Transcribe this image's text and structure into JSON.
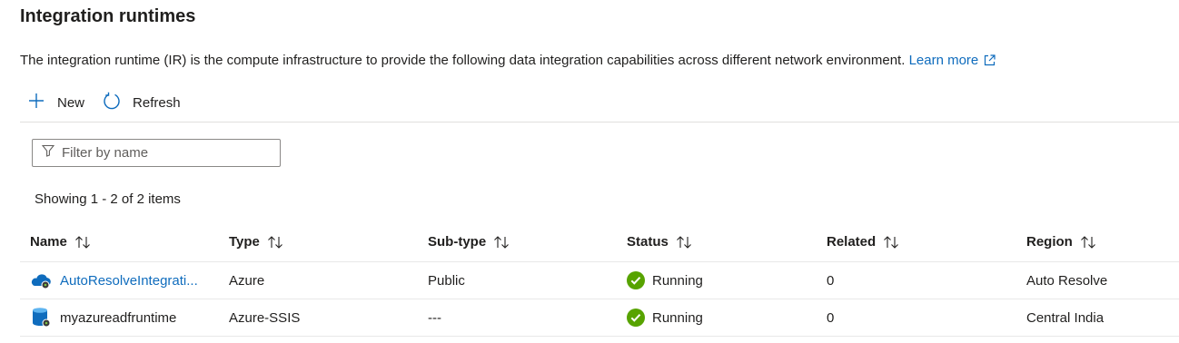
{
  "page": {
    "title": "Integration runtimes",
    "description": "The integration runtime (IR) is the compute infrastructure to provide the following data integration capabilities across different network environment.",
    "learn_more": "Learn more"
  },
  "toolbar": {
    "new_label": "New",
    "refresh_label": "Refresh"
  },
  "filter": {
    "placeholder": "Filter by name",
    "value": ""
  },
  "summary": "Showing 1 - 2 of 2 items",
  "table": {
    "headers": [
      "Name",
      "Type",
      "Sub-type",
      "Status",
      "Related",
      "Region"
    ],
    "rows": [
      {
        "name": "AutoResolveIntegrati...",
        "type": "Azure",
        "subtype": "Public",
        "status": "Running",
        "related": "0",
        "region": "Auto Resolve",
        "icon": "azure-cloud-ir-icon"
      },
      {
        "name": "myazureadfruntime",
        "type": "Azure-SSIS",
        "subtype": "---",
        "status": "Running",
        "related": "0",
        "region": "Central India",
        "icon": "ssis-database-ir-icon"
      }
    ]
  },
  "colors": {
    "link": "#0f6cbd",
    "success": "#57a300",
    "text": "#201f1e",
    "border": "#8a8886"
  }
}
